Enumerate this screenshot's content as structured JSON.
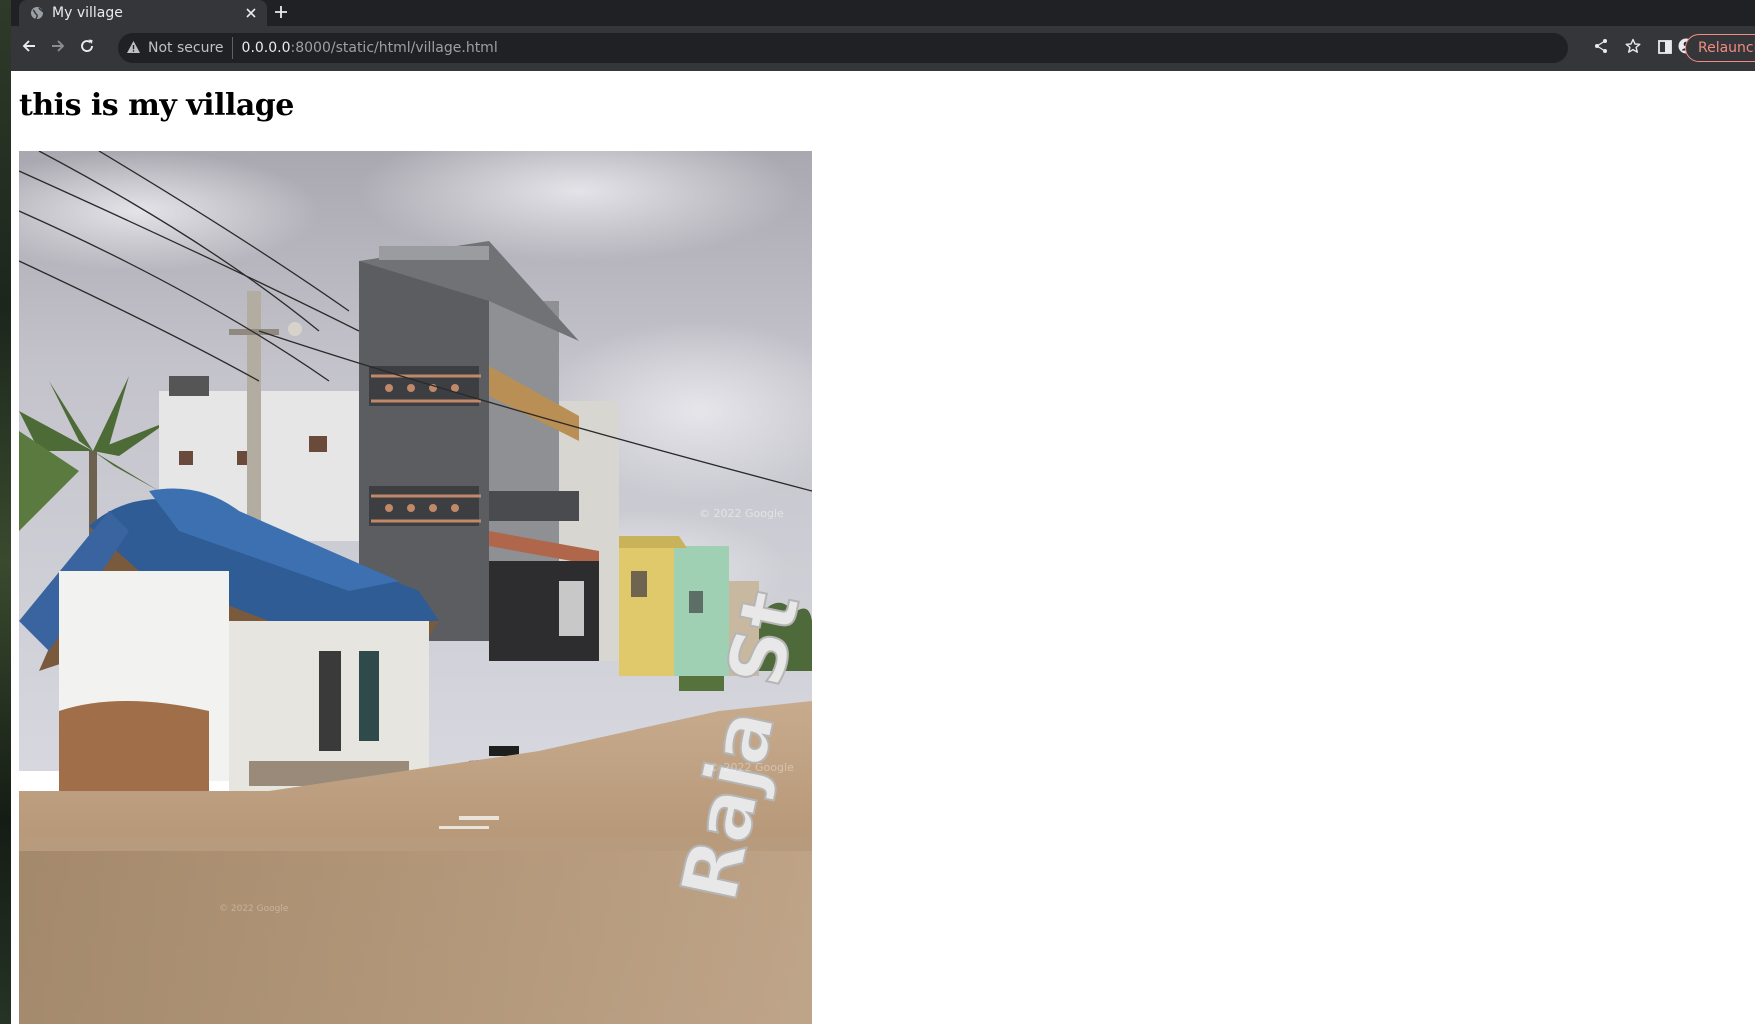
{
  "browser": {
    "tab": {
      "title": "My village",
      "close_glyph": "✕"
    },
    "new_tab_icon": "plus-icon",
    "toolbar": {
      "back_icon": "arrow-left-icon",
      "forward_icon": "arrow-right-icon",
      "reload_icon": "reload-icon",
      "security_label": "Not secure",
      "url_host": "0.0.0.0",
      "url_rest": ":8000/static/html/village.html",
      "share_icon": "share-icon",
      "bookmark_icon": "star-icon",
      "side_panel_icon": "side-panel-icon",
      "profile_icon": "profile-icon",
      "relaunch_label": "Relaunch"
    },
    "colors": {
      "frame": "#202124",
      "toolbar": "#35363a",
      "text": "#e8eaed",
      "relaunch_accent": "#f28b82"
    }
  },
  "page": {
    "heading": "this is my village",
    "image": {
      "subject": "village street photo",
      "street_sign_text": "Raja St",
      "watermark": "© 2022 Google"
    }
  }
}
